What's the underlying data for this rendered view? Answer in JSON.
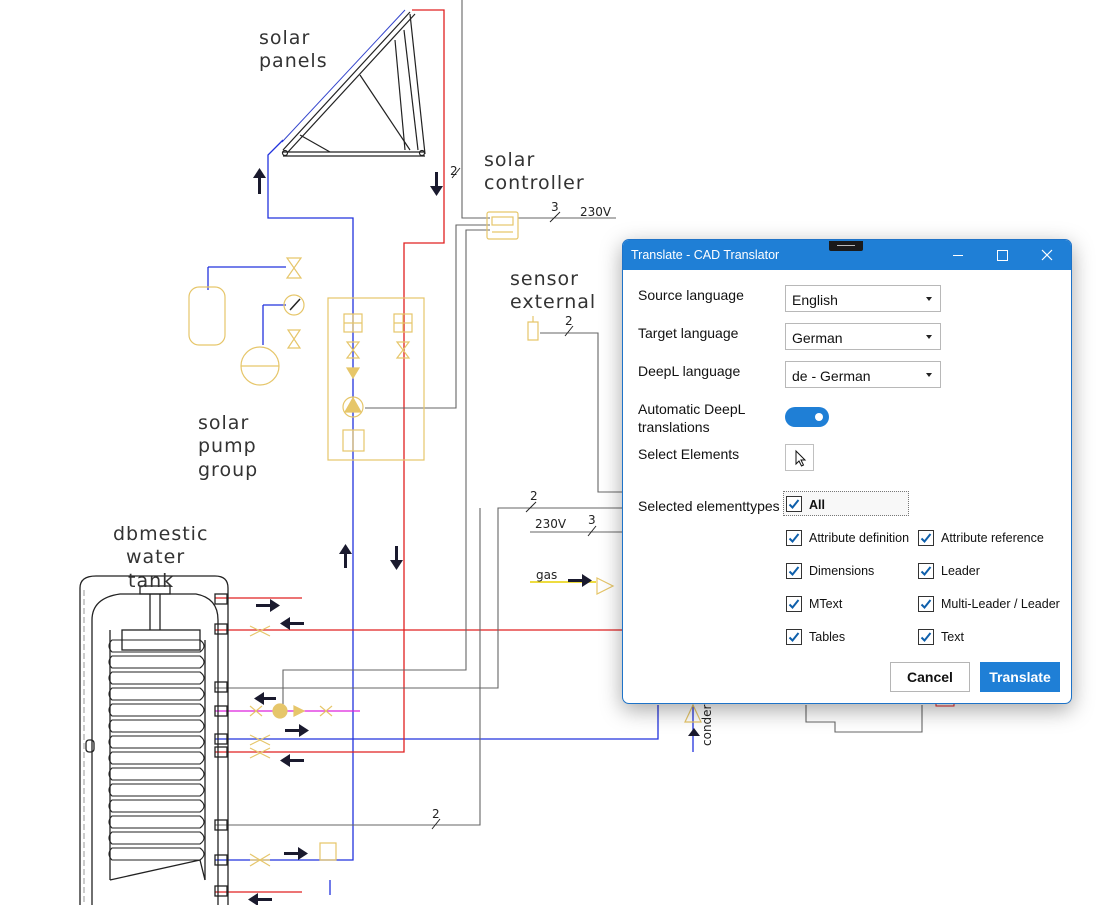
{
  "drawing": {
    "labels": {
      "solar_panels": [
        "solar",
        "panels"
      ],
      "solar_controller": [
        "solar",
        "controller"
      ],
      "sensor_external": [
        "sensor",
        "external"
      ],
      "solar_pump_group": [
        "solar",
        "pump",
        "group"
      ],
      "domestic_water_tank": [
        "dbmestic",
        "water",
        "tank"
      ],
      "gas": "gas",
      "condensate": "conder"
    },
    "wire_counts": [
      "2",
      "3",
      "2",
      "2",
      "3",
      "2"
    ],
    "voltages": [
      "230V",
      "230V"
    ]
  },
  "dialog": {
    "title": "Translate - CAD Translator",
    "source_language": {
      "label": "Source language",
      "value": "English"
    },
    "target_language": {
      "label": "Target language",
      "value": "German"
    },
    "deepl_language": {
      "label": "DeepL language",
      "value": "de - German"
    },
    "auto_deepl": {
      "label_line1": "Automatic DeepL",
      "label_line2": "translations",
      "enabled": true
    },
    "select_elements_label": "Select Elements",
    "selected_types_label": "Selected elementtypes",
    "all_label": "All",
    "element_types": [
      {
        "label": "Attribute definition",
        "checked": true
      },
      {
        "label": "Attribute reference",
        "checked": true
      },
      {
        "label": "Dimensions",
        "checked": true
      },
      {
        "label": "Leader",
        "checked": true
      },
      {
        "label": "MText",
        "checked": true
      },
      {
        "label": "Multi-Leader / Leader",
        "checked": true
      },
      {
        "label": "Tables",
        "checked": true
      },
      {
        "label": "Text",
        "checked": true
      }
    ],
    "cancel_label": "Cancel",
    "translate_label": "Translate",
    "accent_color": "#1f7fd6"
  }
}
